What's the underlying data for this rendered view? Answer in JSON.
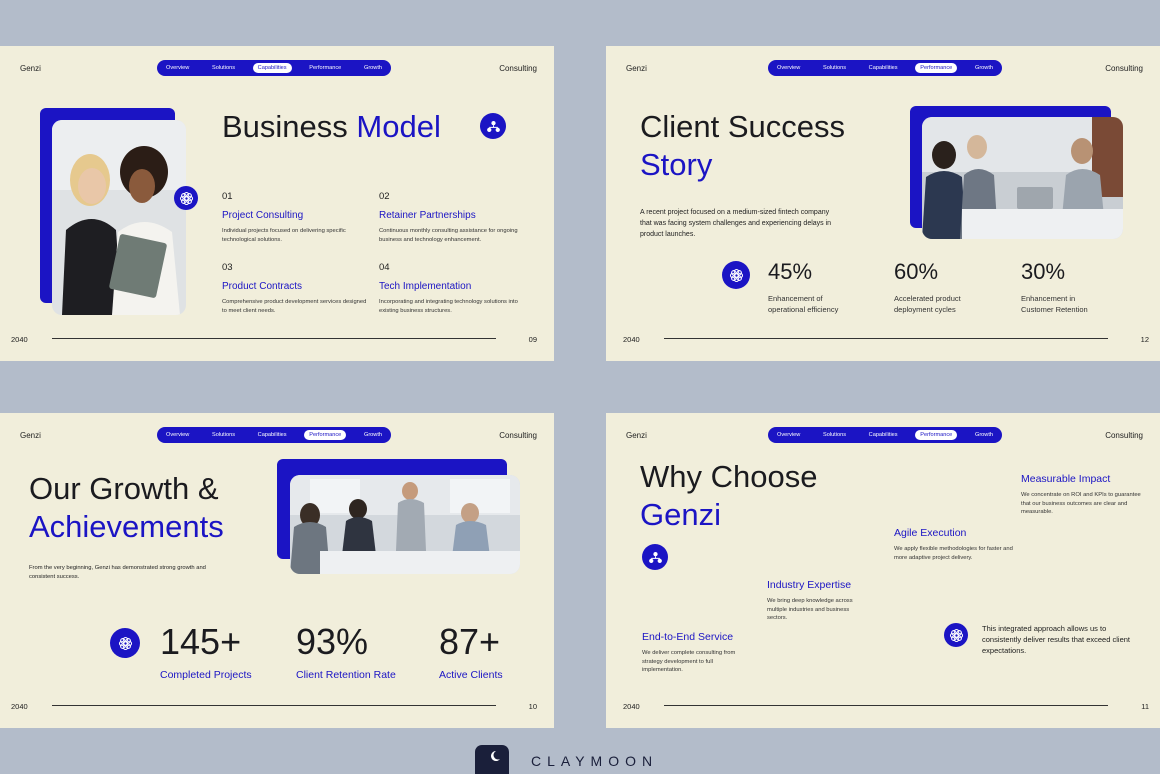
{
  "nav_items": [
    "Overview",
    "Solutions",
    "Capabilities",
    "Performance",
    "Growth"
  ],
  "slides": {
    "business_model": {
      "brand": "Genzi",
      "right_label": "Consulting",
      "active_tab": "Capabilities",
      "title_part1": "Business",
      "title_part2": "Model",
      "items": [
        {
          "num": "01",
          "title": "Project Consulting",
          "desc": "Individual projects focused on delivering specific technological solutions."
        },
        {
          "num": "02",
          "title": "Retainer Partnerships",
          "desc": "Continuous monthly consulting assistance for ongoing business and technology enhancement."
        },
        {
          "num": "03",
          "title": "Product Contracts",
          "desc": "Comprehensive product development services designed to meet client needs."
        },
        {
          "num": "04",
          "title": "Tech Implementation",
          "desc": "Incorporating and integrating technology solutions into existing business structures."
        }
      ],
      "year": "2040",
      "page": "09"
    },
    "client_success": {
      "brand": "Genzi",
      "right_label": "Consulting",
      "active_tab": "Performance",
      "title_part1": "Client Success",
      "title_part2": "Story",
      "paragraph": "A recent project focused on a medium-sized fintech company that was facing system challenges and experiencing delays in product launches.",
      "stats": [
        {
          "value": "45%",
          "caption": "Enhancement of operational efficiency"
        },
        {
          "value": "60%",
          "caption": "Accelerated product deployment cycles"
        },
        {
          "value": "30%",
          "caption": "Enhancement in Customer Retention"
        }
      ],
      "year": "2040",
      "page": "12"
    },
    "growth": {
      "brand": "Genzi",
      "right_label": "Consulting",
      "active_tab": "Performance",
      "title_part1": "Our Growth &",
      "title_part2": "Achievements",
      "paragraph": "From the very beginning, Genzi has demonstrated strong growth and consistent success.",
      "stats": [
        {
          "value": "145+",
          "label": "Completed Projects"
        },
        {
          "value": "93%",
          "label": "Client Retention Rate"
        },
        {
          "value": "87+",
          "label": "Active Clients"
        }
      ],
      "year": "2040",
      "page": "10"
    },
    "why_choose": {
      "brand": "Genzi",
      "right_label": "Consulting",
      "active_tab": "Performance",
      "title_part1": "Why Choose",
      "title_part2": "Genzi",
      "features": [
        {
          "title": "Measurable Impact",
          "desc": "We concentrate on ROI and KPIs to guarantee that our business outcomes are clear and measurable."
        },
        {
          "title": "Agile Execution",
          "desc": "We apply flexible methodologies for faster and more adaptive project delivery."
        },
        {
          "title": "Industry Expertise",
          "desc": "We bring deep knowledge across multiple industries and business sectors."
        },
        {
          "title": "End-to-End Service",
          "desc": "We deliver complete consulting from strategy development to full implementation."
        }
      ],
      "closing": "This integrated approach allows us to consistently deliver results that exceed client expectations.",
      "year": "2040",
      "page": "11"
    }
  },
  "branding": {
    "wordmark": "CLAYMOON"
  },
  "colors": {
    "accent": "#1b14c4",
    "slide_bg": "#f1eedb",
    "canvas_bg": "#b3bcca",
    "logo_dark": "#1a1f3a"
  }
}
